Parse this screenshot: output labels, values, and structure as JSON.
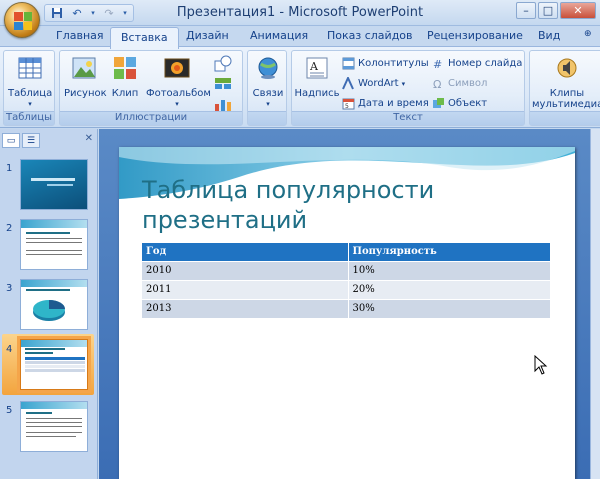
{
  "window": {
    "title": "Презентация1 - Microsoft PowerPoint"
  },
  "tabs": [
    {
      "label": "Главная"
    },
    {
      "label": "Вставка",
      "active": true
    },
    {
      "label": "Дизайн"
    },
    {
      "label": "Анимация"
    },
    {
      "label": "Показ слайдов"
    },
    {
      "label": "Рецензирование"
    },
    {
      "label": "Вид"
    }
  ],
  "ribbon": {
    "groups": {
      "tables": {
        "label": "Таблицы",
        "buttons": {
          "table": "Таблица"
        }
      },
      "illustrations": {
        "label": "Иллюстрации",
        "buttons": {
          "picture": "Рисунок",
          "clip": "Клип",
          "album": "Фотоальбом"
        }
      },
      "links": {
        "buttons": {
          "links": "Связи"
        }
      },
      "text": {
        "label": "Текст",
        "buttons": {
          "textbox": "Надпись",
          "header_footer": "Колонтитулы",
          "wordart": "WordArt",
          "datetime": "Дата и время",
          "slide_number": "Номер слайда",
          "symbol": "Символ",
          "object": "Объект"
        }
      },
      "media": {
        "buttons": {
          "clips": "Клипы",
          "clips2": "мультимедиа"
        }
      }
    }
  },
  "slides_panel": {
    "numbers": [
      "1",
      "2",
      "3",
      "4",
      "5"
    ],
    "selected": 4
  },
  "slide": {
    "title": "Таблица популярности презентаций",
    "table": {
      "headers": [
        "Год",
        "Популярность"
      ],
      "rows": [
        [
          "2010",
          "10%"
        ],
        [
          "2011",
          "20%"
        ],
        [
          "2013",
          "30%"
        ]
      ]
    }
  },
  "colors": {
    "table_header": "#1f73c2",
    "title_text": "#1f6f86",
    "selected_thumb": "#f5a54a"
  }
}
